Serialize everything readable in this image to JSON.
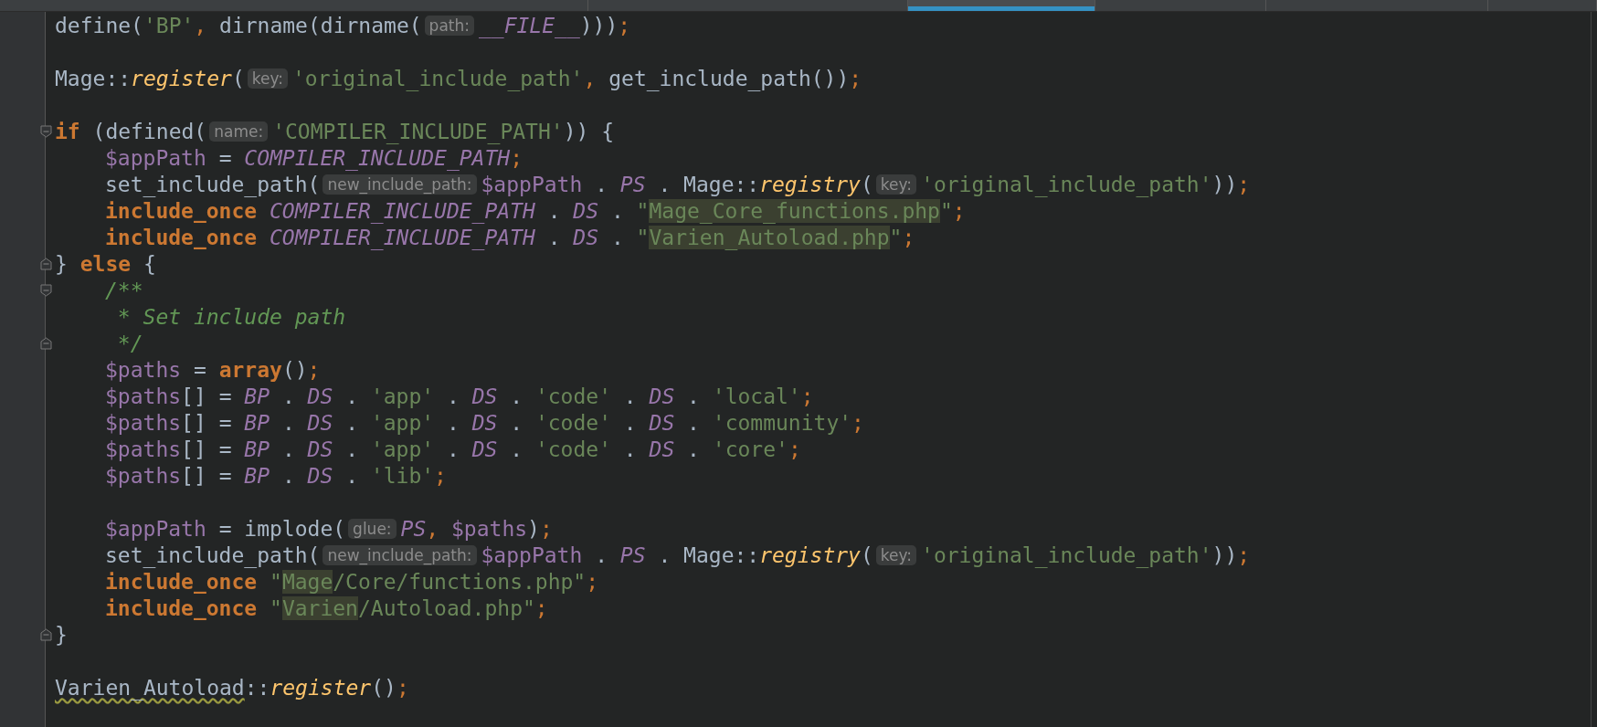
{
  "tabs": [
    {
      "selected": false
    },
    {
      "selected": false
    },
    {
      "selected": true
    },
    {
      "selected": false
    },
    {
      "selected": false
    },
    {
      "selected": false
    }
  ],
  "lines": [
    {
      "kind": "code",
      "tokens": [
        {
          "kind": "plain",
          "text": "define("
        },
        {
          "kind": "string",
          "text": "'BP'"
        },
        {
          "kind": "punct",
          "text": ","
        },
        {
          "kind": "plain",
          "text": " dirname(dirname("
        },
        {
          "kind": "hint",
          "text": "path:"
        },
        {
          "kind": "constant",
          "text": "__FILE__"
        },
        {
          "kind": "plain",
          "text": ")))"
        },
        {
          "kind": "punct",
          "text": ";"
        }
      ]
    },
    {
      "kind": "blank"
    },
    {
      "kind": "code",
      "tokens": [
        {
          "kind": "plain",
          "text": "Mage::"
        },
        {
          "kind": "method",
          "text": "register"
        },
        {
          "kind": "plain",
          "text": "("
        },
        {
          "kind": "hint",
          "text": "key:"
        },
        {
          "kind": "string",
          "text": "'original_include_path'"
        },
        {
          "kind": "punct",
          "text": ","
        },
        {
          "kind": "plain",
          "text": " get_include_path())"
        },
        {
          "kind": "punct",
          "text": ";"
        }
      ]
    },
    {
      "kind": "blank"
    },
    {
      "kind": "fold_start",
      "tokens": [
        {
          "kind": "keyword",
          "text": "if"
        },
        {
          "kind": "plain",
          "text": " (defined("
        },
        {
          "kind": "hint",
          "text": "name:"
        },
        {
          "kind": "string",
          "text": "'COMPILER_INCLUDE_PATH'"
        },
        {
          "kind": "plain",
          "text": ")) {"
        }
      ],
      "children": [
        {
          "kind": "code",
          "tokens": [
            {
              "kind": "variable",
              "text": "$appPath"
            },
            {
              "kind": "plain",
              "text": " = "
            },
            {
              "kind": "constant",
              "text": "COMPILER_INCLUDE_PATH"
            },
            {
              "kind": "punct",
              "text": ";"
            }
          ]
        },
        {
          "kind": "code",
          "tokens": [
            {
              "kind": "plain",
              "text": "set_include_path("
            },
            {
              "kind": "hint",
              "text": "new_include_path:"
            },
            {
              "kind": "variable",
              "text": "$appPath"
            },
            {
              "kind": "plain",
              "text": " . "
            },
            {
              "kind": "constant",
              "text": "PS"
            },
            {
              "kind": "plain",
              "text": " . Mage::"
            },
            {
              "kind": "method",
              "text": "registry"
            },
            {
              "kind": "plain",
              "text": "("
            },
            {
              "kind": "hint",
              "text": "key:"
            },
            {
              "kind": "string",
              "text": "'original_include_path'"
            },
            {
              "kind": "plain",
              "text": "))"
            },
            {
              "kind": "punct",
              "text": ";"
            }
          ]
        },
        {
          "kind": "code",
          "tokens": [
            {
              "kind": "keyword",
              "text": "include_once"
            },
            {
              "kind": "constant",
              "text": " COMPILER_INCLUDE_PATH"
            },
            {
              "kind": "plain",
              "text": " . "
            },
            {
              "kind": "constant",
              "text": "DS"
            },
            {
              "kind": "plain",
              "text": " . "
            },
            {
              "kind": "string",
              "text": "\""
            },
            {
              "kind": "match",
              "text": "Mage_Core_functions.php"
            },
            {
              "kind": "string",
              "text": "\""
            },
            {
              "kind": "punct",
              "text": ";"
            }
          ]
        },
        {
          "kind": "code",
          "tokens": [
            {
              "kind": "keyword",
              "text": "include_once"
            },
            {
              "kind": "constant",
              "text": " COMPILER_INCLUDE_PATH"
            },
            {
              "kind": "plain",
              "text": " . "
            },
            {
              "kind": "constant",
              "text": "DS"
            },
            {
              "kind": "plain",
              "text": " . "
            },
            {
              "kind": "string",
              "text": "\""
            },
            {
              "kind": "match",
              "text": "Varien_Autoload.php"
            },
            {
              "kind": "string",
              "text": "\""
            },
            {
              "kind": "punct",
              "text": ";"
            }
          ]
        }
      ]
    },
    {
      "kind": "fold_end",
      "tokens": [
        {
          "kind": "plain",
          "text": "} "
        },
        {
          "kind": "keyword",
          "text": "else"
        },
        {
          "kind": "plain",
          "text": " {"
        }
      ],
      "children": [
        {
          "kind": "fold_start",
          "tokens": [
            {
              "kind": "comment",
              "text": "/**"
            }
          ]
        },
        {
          "kind": "code",
          "tokens": [
            {
              "kind": "comment",
              "text": " * Set include path"
            }
          ]
        },
        {
          "kind": "fold_end",
          "tokens": [
            {
              "kind": "comment",
              "text": " */"
            }
          ]
        },
        {
          "kind": "code",
          "tokens": [
            {
              "kind": "variable",
              "text": "$paths"
            },
            {
              "kind": "plain",
              "text": " = "
            },
            {
              "kind": "keyword",
              "text": "array"
            },
            {
              "kind": "plain",
              "text": "()"
            },
            {
              "kind": "punct",
              "text": ";"
            }
          ]
        },
        {
          "kind": "code",
          "tokens": [
            {
              "kind": "variable",
              "text": "$paths"
            },
            {
              "kind": "plain",
              "text": "[] = "
            },
            {
              "kind": "constant",
              "text": "BP"
            },
            {
              "kind": "plain",
              "text": " . "
            },
            {
              "kind": "constant",
              "text": "DS"
            },
            {
              "kind": "plain",
              "text": " . "
            },
            {
              "kind": "string",
              "text": "'app'"
            },
            {
              "kind": "plain",
              "text": " . "
            },
            {
              "kind": "constant",
              "text": "DS"
            },
            {
              "kind": "plain",
              "text": " . "
            },
            {
              "kind": "string",
              "text": "'code'"
            },
            {
              "kind": "plain",
              "text": " . "
            },
            {
              "kind": "constant",
              "text": "DS"
            },
            {
              "kind": "plain",
              "text": " . "
            },
            {
              "kind": "string",
              "text": "'local'"
            },
            {
              "kind": "punct",
              "text": ";"
            }
          ]
        },
        {
          "kind": "code",
          "tokens": [
            {
              "kind": "variable",
              "text": "$paths"
            },
            {
              "kind": "plain",
              "text": "[] = "
            },
            {
              "kind": "constant",
              "text": "BP"
            },
            {
              "kind": "plain",
              "text": " . "
            },
            {
              "kind": "constant",
              "text": "DS"
            },
            {
              "kind": "plain",
              "text": " . "
            },
            {
              "kind": "string",
              "text": "'app'"
            },
            {
              "kind": "plain",
              "text": " . "
            },
            {
              "kind": "constant",
              "text": "DS"
            },
            {
              "kind": "plain",
              "text": " . "
            },
            {
              "kind": "string",
              "text": "'code'"
            },
            {
              "kind": "plain",
              "text": " . "
            },
            {
              "kind": "constant",
              "text": "DS"
            },
            {
              "kind": "plain",
              "text": " . "
            },
            {
              "kind": "string",
              "text": "'community'"
            },
            {
              "kind": "punct",
              "text": ";"
            }
          ]
        },
        {
          "kind": "code",
          "tokens": [
            {
              "kind": "variable",
              "text": "$paths"
            },
            {
              "kind": "plain",
              "text": "[] = "
            },
            {
              "kind": "constant",
              "text": "BP"
            },
            {
              "kind": "plain",
              "text": " . "
            },
            {
              "kind": "constant",
              "text": "DS"
            },
            {
              "kind": "plain",
              "text": " . "
            },
            {
              "kind": "string",
              "text": "'app'"
            },
            {
              "kind": "plain",
              "text": " . "
            },
            {
              "kind": "constant",
              "text": "DS"
            },
            {
              "kind": "plain",
              "text": " . "
            },
            {
              "kind": "string",
              "text": "'code'"
            },
            {
              "kind": "plain",
              "text": " . "
            },
            {
              "kind": "constant",
              "text": "DS"
            },
            {
              "kind": "plain",
              "text": " . "
            },
            {
              "kind": "string",
              "text": "'core'"
            },
            {
              "kind": "punct",
              "text": ";"
            }
          ]
        },
        {
          "kind": "code",
          "tokens": [
            {
              "kind": "variable",
              "text": "$paths"
            },
            {
              "kind": "plain",
              "text": "[] = "
            },
            {
              "kind": "constant",
              "text": "BP"
            },
            {
              "kind": "plain",
              "text": " . "
            },
            {
              "kind": "constant",
              "text": "DS"
            },
            {
              "kind": "plain",
              "text": " . "
            },
            {
              "kind": "string",
              "text": "'lib'"
            },
            {
              "kind": "punct",
              "text": ";"
            }
          ]
        },
        {
          "kind": "blank"
        },
        {
          "kind": "code",
          "tokens": [
            {
              "kind": "variable",
              "text": "$appPath"
            },
            {
              "kind": "plain",
              "text": " = implode("
            },
            {
              "kind": "hint",
              "text": "glue:"
            },
            {
              "kind": "constant",
              "text": "PS"
            },
            {
              "kind": "punct",
              "text": ", "
            },
            {
              "kind": "variable",
              "text": "$paths"
            },
            {
              "kind": "plain",
              "text": ")"
            },
            {
              "kind": "punct",
              "text": ";"
            }
          ]
        },
        {
          "kind": "code",
          "tokens": [
            {
              "kind": "plain",
              "text": "set_include_path("
            },
            {
              "kind": "hint",
              "text": "new_include_path:"
            },
            {
              "kind": "variable",
              "text": "$appPath"
            },
            {
              "kind": "plain",
              "text": " . "
            },
            {
              "kind": "constant",
              "text": "PS"
            },
            {
              "kind": "plain",
              "text": " . Mage::"
            },
            {
              "kind": "method",
              "text": "registry"
            },
            {
              "kind": "plain",
              "text": "("
            },
            {
              "kind": "hint",
              "text": "key:"
            },
            {
              "kind": "string",
              "text": "'original_include_path'"
            },
            {
              "kind": "plain",
              "text": "))"
            },
            {
              "kind": "punct",
              "text": ";"
            }
          ]
        },
        {
          "kind": "code",
          "tokens": [
            {
              "kind": "keyword",
              "text": "include_once"
            },
            {
              "kind": "string",
              "text": " \""
            },
            {
              "kind": "match",
              "text": "Mage"
            },
            {
              "kind": "string",
              "text": "/Core/functions.php\""
            },
            {
              "kind": "punct",
              "text": ";"
            }
          ]
        },
        {
          "kind": "code",
          "tokens": [
            {
              "kind": "keyword",
              "text": "include_once"
            },
            {
              "kind": "string",
              "text": " \""
            },
            {
              "kind": "match",
              "text": "Varien"
            },
            {
              "kind": "string",
              "text": "/Autoload.php\""
            },
            {
              "kind": "punct",
              "text": ";"
            }
          ]
        }
      ]
    },
    {
      "kind": "fold_end",
      "tokens": [
        {
          "kind": "plain",
          "text": "}"
        }
      ]
    },
    {
      "kind": "blank"
    },
    {
      "kind": "code",
      "tokens": [
        {
          "kind": "unresolved",
          "text": "Varien_Autoload"
        },
        {
          "kind": "plain",
          "text": "::"
        },
        {
          "kind": "method",
          "text": "register"
        },
        {
          "kind": "plain",
          "text": "()"
        },
        {
          "kind": "punct",
          "text": ";"
        }
      ]
    }
  ]
}
